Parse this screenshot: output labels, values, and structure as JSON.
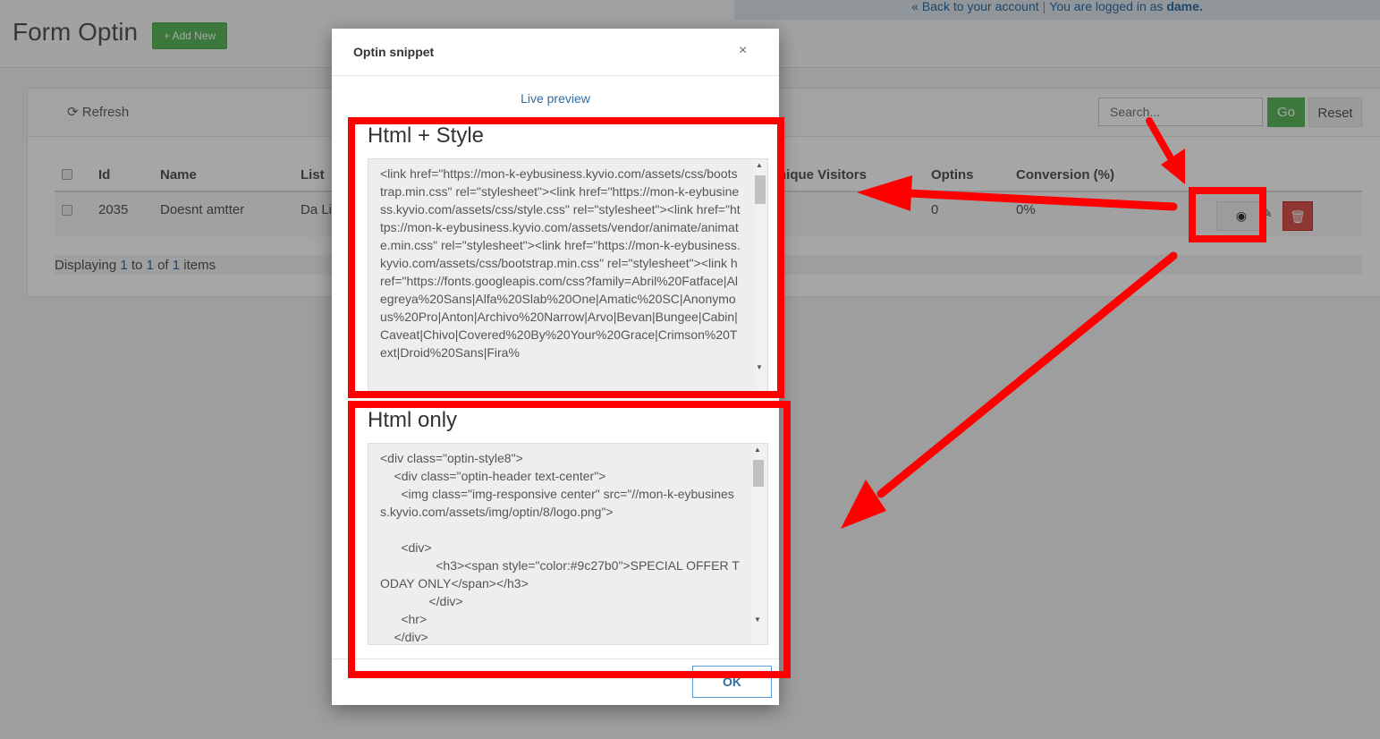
{
  "topbar": {
    "back_link": "« Back to your account",
    "sep": "|",
    "logged_in": "You are logged in as",
    "user": "dame."
  },
  "header": {
    "title": "Form Optin",
    "add_new": "+ Add New"
  },
  "toolbar": {
    "refresh": "Refresh",
    "search_placeholder": "Search...",
    "go": "Go",
    "reset": "Reset"
  },
  "table": {
    "columns": [
      "Id",
      "Name",
      "List",
      "nique Visitors",
      "Optins",
      "Conversion (%)"
    ],
    "rows": [
      {
        "id": "2035",
        "name": "Doesnt amtter",
        "list": "Da Lis",
        "optins": "0",
        "conversion": "0%"
      }
    ],
    "displaying_prefix": "Displaying",
    "from": "1",
    "to_word": "to",
    "to": "1",
    "of_word": "of",
    "total": "1",
    "items_word": "items"
  },
  "modal": {
    "title": "Optin snippet",
    "close": "×",
    "live_preview": "Live preview",
    "section1_title": "Html + Style",
    "section1_code": "<link href=\"https://mon-k-eybusiness.kyvio.com/assets/css/bootstrap.min.css\" rel=\"stylesheet\"><link href=\"https://mon-k-eybusiness.kyvio.com/assets/css/style.css\" rel=\"stylesheet\"><link href=\"https://mon-k-eybusiness.kyvio.com/assets/vendor/animate/animate.min.css\" rel=\"stylesheet\"><link href=\"https://mon-k-eybusiness.kyvio.com/assets/css/bootstrap.min.css\" rel=\"stylesheet\"><link href=\"https://fonts.googleapis.com/css?family=Abril%20Fatface|Alegreya%20Sans|Alfa%20Slab%20One|Amatic%20SC|Anonymous%20Pro|Anton|Archivo%20Narrow|Arvo|Bevan|Bungee|Cabin|Caveat|Chivo|Covered%20By%20Your%20Grace|Crimson%20Text|Droid%20Sans|Fira%",
    "section2_title": "Html only",
    "section2_code": "<div class=\"optin-style8\">\n    <div class=\"optin-header text-center\">\n      <img class=\"img-responsive center\" src=\"//mon-k-eybusiness.kyvio.com/assets/img/optin/8/logo.png\">\n\n      <div>\n                <h3><span style=\"color:#9c27b0\">SPECIAL OFFER TODAY ONLY</span></h3>\n              </div>\n      <hr>\n    </div>",
    "ok": "OK"
  },
  "colors": {
    "annotation": "#ff0000",
    "primary_link": "#2f6da3",
    "success": "#5cb85c",
    "danger": "#d9534f"
  }
}
